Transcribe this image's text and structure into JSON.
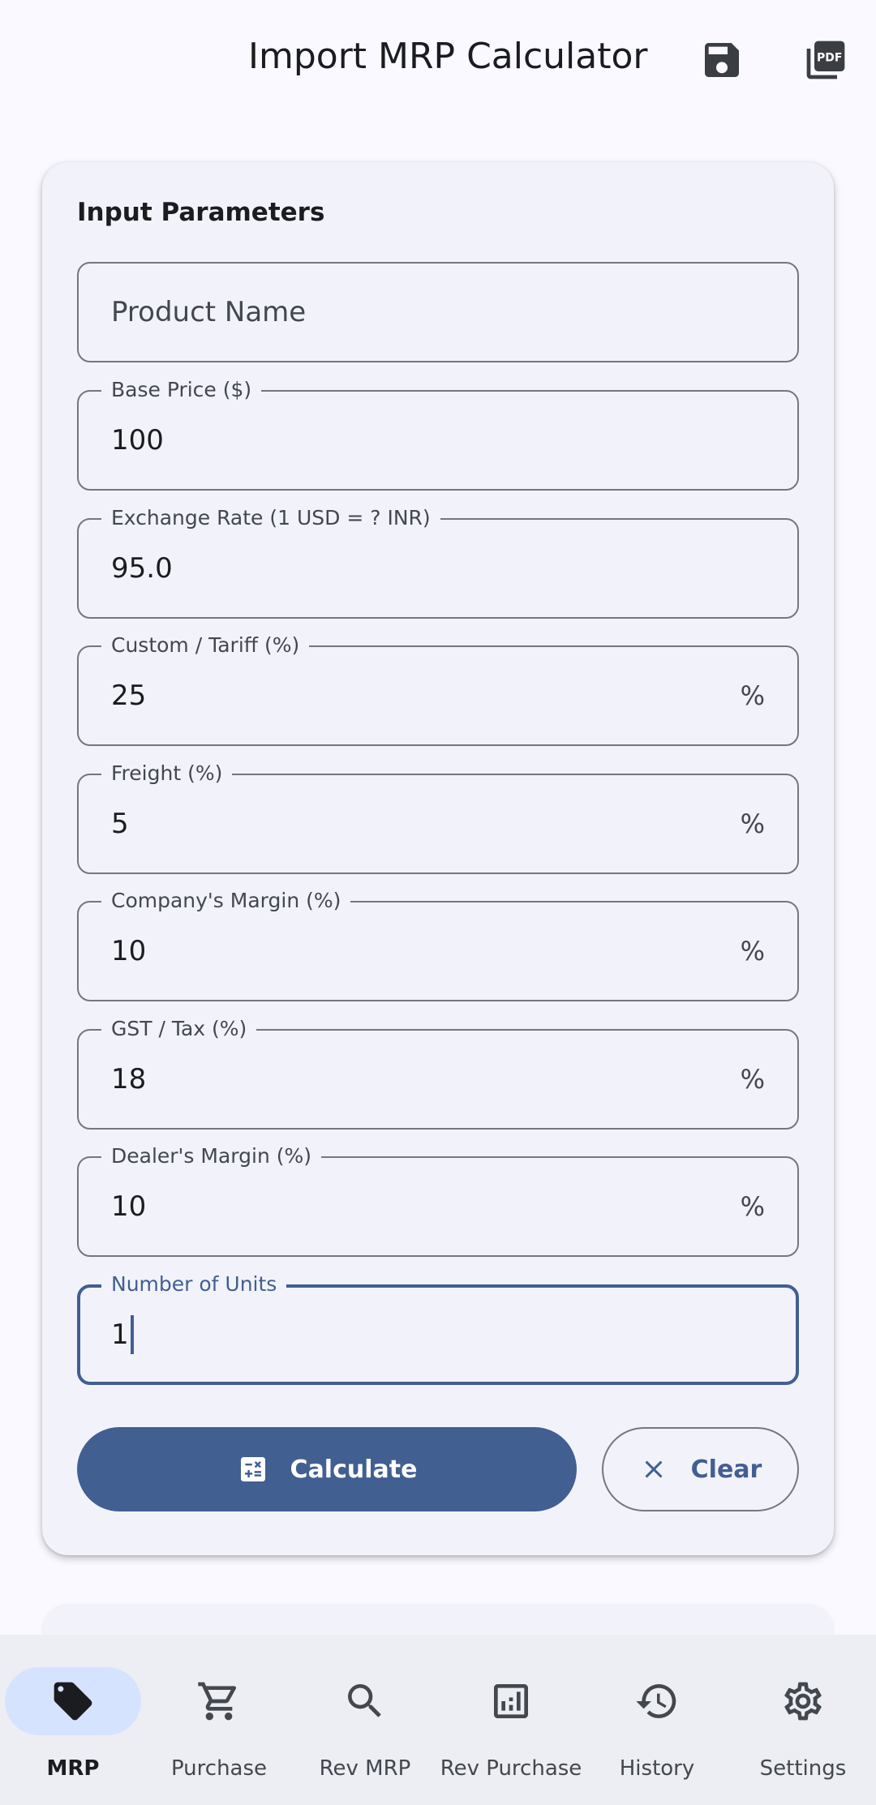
{
  "app": {
    "title": "Import MRP Calculator",
    "save_icon": "save-icon",
    "pdf_icon": "pdf-icon",
    "pdf_text": "PDF"
  },
  "colors": {
    "primary": "#415f91",
    "background": "#f9f9ff",
    "surface": "#f2f3fa",
    "outline": "#73777f",
    "nav_active": "#d6e3ff"
  },
  "form": {
    "section_title": "Input Parameters",
    "product_name": {
      "placeholder": "Product Name",
      "value": ""
    },
    "base_price": {
      "label": "Base Price ($)",
      "value": "100"
    },
    "exchange_rate": {
      "label": "Exchange Rate (1 USD = ? INR)",
      "value": "95.0"
    },
    "custom_tariff": {
      "label": "Custom / Tariff (%)",
      "value": "25",
      "suffix": "%"
    },
    "freight": {
      "label": "Freight (%)",
      "value": "5",
      "suffix": "%"
    },
    "company_margin": {
      "label": "Company's Margin (%)",
      "value": "10",
      "suffix": "%"
    },
    "gst_tax": {
      "label": "GST / Tax (%)",
      "value": "18",
      "suffix": "%"
    },
    "dealer_margin": {
      "label": "Dealer's Margin (%)",
      "value": "10",
      "suffix": "%"
    },
    "units": {
      "label": "Number of Units",
      "value": "1"
    }
  },
  "buttons": {
    "calculate": "Calculate",
    "clear": "Clear"
  },
  "nav": {
    "items": [
      {
        "label": "MRP",
        "icon": "tag-icon",
        "active": true
      },
      {
        "label": "Purchase",
        "icon": "cart-icon",
        "active": false
      },
      {
        "label": "Rev MRP",
        "icon": "search-icon",
        "active": false
      },
      {
        "label": "Rev Purchase",
        "icon": "chart-icon",
        "active": false
      },
      {
        "label": "History",
        "icon": "history-icon",
        "active": false
      },
      {
        "label": "Settings",
        "icon": "gear-icon",
        "active": false
      }
    ]
  }
}
